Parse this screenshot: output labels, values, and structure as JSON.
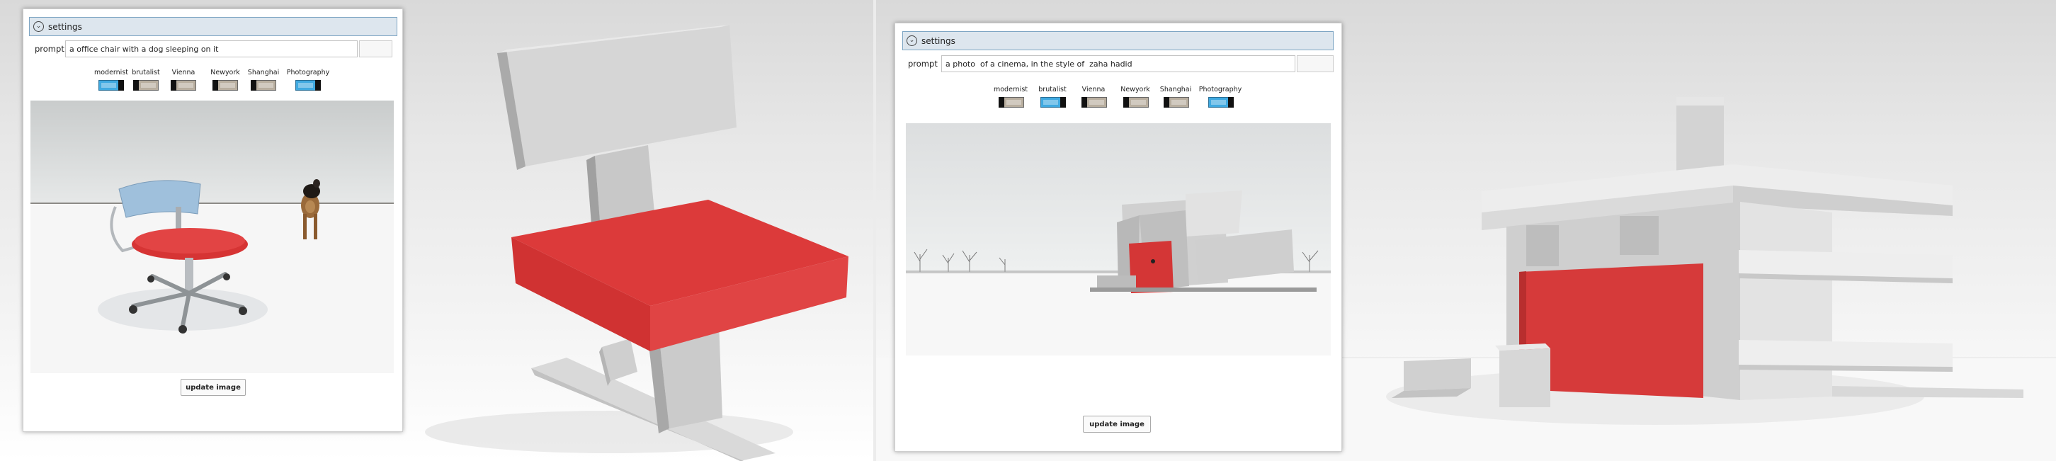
{
  "left": {
    "settings_label": "settings",
    "prompt_label": "prompt",
    "prompt_value": "a office chair with a dog sleeping on it",
    "styles": [
      {
        "label": "modernist",
        "on": true
      },
      {
        "label": "brutalist",
        "on": false
      },
      {
        "label": "Vienna",
        "on": false
      },
      {
        "label": "Newyork",
        "on": false
      },
      {
        "label": "Shanghai",
        "on": false
      },
      {
        "label": "Photography",
        "on": true
      }
    ],
    "update_label": "update image"
  },
  "right": {
    "settings_label": "settings",
    "prompt_label": "prompt",
    "prompt_value": "a photo  of a cinema, in the style of  zaha hadid",
    "styles": [
      {
        "label": "modernist",
        "on": false
      },
      {
        "label": "brutalist",
        "on": true
      },
      {
        "label": "Vienna",
        "on": false
      },
      {
        "label": "Newyork",
        "on": false
      },
      {
        "label": "Shanghai",
        "on": false
      },
      {
        "label": "Photography",
        "on": true
      }
    ],
    "update_label": "update image"
  },
  "colors": {
    "accent_red": "#e23a3a",
    "toggle_on": "#3fa9e0",
    "toggle_off": "#b8ae9f"
  }
}
